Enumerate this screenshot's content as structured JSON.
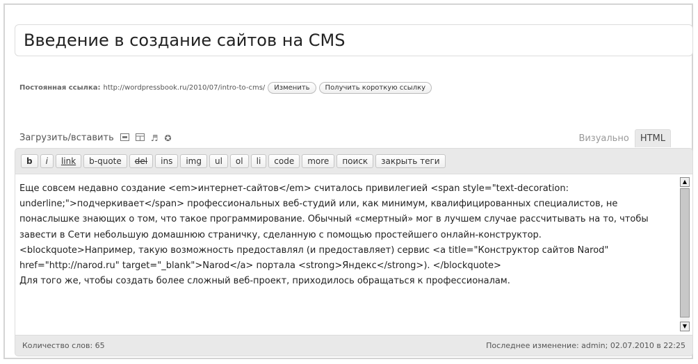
{
  "post": {
    "title": "Введение в создание сайтов на CMS"
  },
  "permalink": {
    "label": "Постоянная ссылка:",
    "url": "http://wordpressbook.ru/2010/07/intro-to-cms/",
    "edit_button": "Изменить",
    "shortlink_button": "Получить короткую ссылку"
  },
  "media": {
    "label": "Загрузить/вставить",
    "icons": [
      "image-icon",
      "video-icon",
      "audio-icon",
      "media-icon"
    ]
  },
  "tabs": {
    "visual": "Визуально",
    "html": "HTML",
    "active": "html"
  },
  "quicktags": {
    "b": "b",
    "i": "i",
    "link": "link",
    "bquote": "b-quote",
    "del": "del",
    "ins": "ins",
    "img": "img",
    "ul": "ul",
    "ol": "ol",
    "li": "li",
    "code": "code",
    "more": "more",
    "search": "поиск",
    "close_tags": "закрыть теги"
  },
  "content": {
    "paragraph1": "Еще совсем недавно создание <em>интернет-сайтов</em> считалось привилегией <span style=\"text-decoration: underline;\">подчеркивает</span> профессиональных веб-студий или, как минимум, квалифицированных специалистов, не понаслышке знающих о том, что такое программирование. Обычный «смертный» мог в лучшем случае рассчитывать на то, чтобы завести в Сети небольшую домашнюю страничку, сделанную с помощью простейшего онлайн-конструктор.",
    "paragraph2": "<blockquote>Например, такую возможность предоставлял (и предоставляет) сервис <a title=\"Конструктор сайтов Narod\" href=\"http://narod.ru\" target=\"_blank\">Narod</a> портала <strong>Яндекс</strong>). </blockquote>",
    "paragraph3": "Для того же, чтобы создать более сложный веб-проект, приходилось обращаться к профессионалам."
  },
  "status": {
    "word_count": "Количество слов: 65",
    "last_edit": "Последнее изменение: admin; 02.07.2010 в 22:25"
  },
  "colors": {
    "border": "#dcdcdc",
    "toolbar_bg": "#e9e9e9",
    "text": "#222222"
  }
}
